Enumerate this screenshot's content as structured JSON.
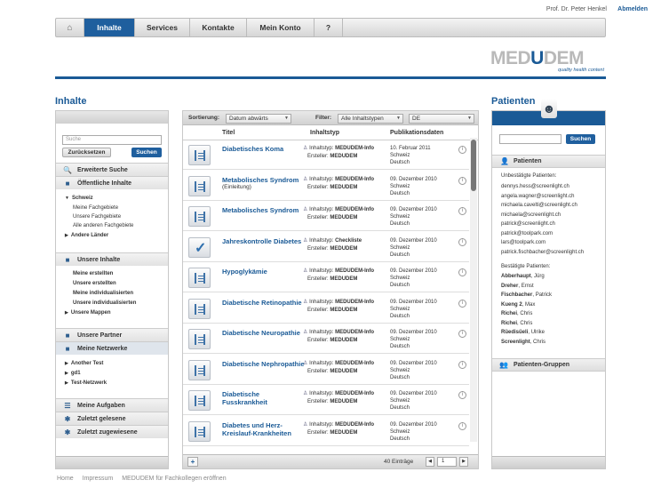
{
  "header": {
    "user": "Prof. Dr. Peter Henkel",
    "logout": "Abmelden"
  },
  "nav": {
    "home_icon": "home-icon",
    "items": [
      "Inhalte",
      "Services",
      "Kontakte",
      "Mein Konto",
      "?"
    ],
    "active": "Inhalte"
  },
  "logo": {
    "text_a": "MED",
    "text_b": "U",
    "text_c": "DEM",
    "tagline": "quality health content"
  },
  "sections": {
    "left_title": "Inhalte",
    "right_title": "Patienten"
  },
  "left": {
    "search_placeholder": "Suche",
    "reset": "Zurücksetzen",
    "search": "Suchen",
    "adv": "Erweiterte Suche",
    "public": "Öffentliche Inhalte",
    "schweiz": "Schweiz",
    "fach1": "Meine Fachgebiete",
    "fach2": "Unsere Fachgebiete",
    "fach3": "Alle anderen Fachgebiete",
    "andere": "Andere Länder",
    "unsere": "Unsere Inhalte",
    "u1": "Meine erstellten",
    "u2": "Unsere erstellten",
    "u3": "Meine individualisierten",
    "u4": "Unsere individualisierten",
    "u5": "Unsere Mappen",
    "partner": "Unsere Partner",
    "netz": "Meine Netzwerke",
    "n1": "Another Test",
    "n2": "gd1",
    "n3": "Test-Netzwerk",
    "aufg": "Meine Aufgaben",
    "gel": "Zuletzt gelesene",
    "zug": "Zuletzt zugewiesene"
  },
  "content": {
    "sort_label": "Sortierung:",
    "sort_value": "Datum abwärts",
    "filter_label": "Filter:",
    "filter_value": "Alle Inhaltstypen",
    "lang_value": "DE",
    "col_title": "Titel",
    "col_type": "Inhaltstyp",
    "col_date": "Publikationsdaten",
    "rows": [
      {
        "title": "Diabetisches Koma",
        "sub": "",
        "type": "MEDUDEM-Info",
        "creator": "MEDUDEM",
        "date": "10. Februar 2011",
        "country": "Schweiz",
        "lang": "Deutsch",
        "icon": "doc"
      },
      {
        "title": "Metabolisches Syndrom",
        "sub": "(Einleitung)",
        "type": "MEDUDEM-Info",
        "creator": "MEDUDEM",
        "date": "09. Dezember 2010",
        "country": "Schweiz",
        "lang": "Deutsch",
        "icon": "doc"
      },
      {
        "title": "Metabolisches Syndrom",
        "sub": "",
        "type": "MEDUDEM-Info",
        "creator": "MEDUDEM",
        "date": "09. Dezember 2010",
        "country": "Schweiz",
        "lang": "Deutsch",
        "icon": "doc"
      },
      {
        "title": "Jahreskontrolle Diabetes",
        "sub": "",
        "type": "Checkliste",
        "creator": "MEDUDEM",
        "date": "09. Dezember 2010",
        "country": "Schweiz",
        "lang": "Deutsch",
        "icon": "check"
      },
      {
        "title": "Hypoglykämie",
        "sub": "",
        "type": "MEDUDEM-Info",
        "creator": "MEDUDEM",
        "date": "09. Dezember 2010",
        "country": "Schweiz",
        "lang": "Deutsch",
        "icon": "doc"
      },
      {
        "title": "Diabetische Retinopathie",
        "sub": "",
        "type": "MEDUDEM-Info",
        "creator": "MEDUDEM",
        "date": "09. Dezember 2010",
        "country": "Schweiz",
        "lang": "Deutsch",
        "icon": "doc"
      },
      {
        "title": "Diabetische Neuropathie",
        "sub": "",
        "type": "MEDUDEM-Info",
        "creator": "MEDUDEM",
        "date": "09. Dezember 2010",
        "country": "Schweiz",
        "lang": "Deutsch",
        "icon": "doc"
      },
      {
        "title": "Diabetische Nephropathie",
        "sub": "",
        "type": "MEDUDEM-Info",
        "creator": "MEDUDEM",
        "date": "09. Dezember 2010",
        "country": "Schweiz",
        "lang": "Deutsch",
        "icon": "doc"
      },
      {
        "title": "Diabetische Fusskrankheit",
        "sub": "",
        "type": "MEDUDEM-Info",
        "creator": "MEDUDEM",
        "date": "09. Dezember 2010",
        "country": "Schweiz",
        "lang": "Deutsch",
        "icon": "doc"
      },
      {
        "title": "Diabetes und Herz-Kreislauf-Krankheiten",
        "sub": "",
        "type": "MEDUDEM-Info",
        "creator": "MEDUDEM",
        "date": "09. Dezember 2010",
        "country": "Schweiz",
        "lang": "Deutsch",
        "icon": "doc"
      }
    ],
    "type_label": "Inhaltstyp:",
    "creator_label": "Ersteller:",
    "add": "+",
    "count": "40 Einträge",
    "page": "1",
    "page_of": "1"
  },
  "right": {
    "search": "Suchen",
    "patients": "Patienten",
    "unconfirmed_label": "Unbestätigte Patienten:",
    "unconfirmed": [
      "dennys.hess@screenlight.ch",
      "angela.wagner@screenlight.ch",
      "michaela.cavelti@screenlight.ch",
      "michaela@screenlight.ch",
      "patrick@screenlight.ch",
      "patrick@toolpark.com",
      "lars@toolpark.com",
      "patrick.fischbacher@screenlight.ch"
    ],
    "confirmed_label": "Bestätigte Patienten:",
    "confirmed": [
      [
        "Abberhaupt",
        "Jürg"
      ],
      [
        "Dreher",
        "Ernst"
      ],
      [
        "Fischbacher",
        "Patrick"
      ],
      [
        "Kueng 2",
        "Max"
      ],
      [
        "Richei",
        "Chris"
      ],
      [
        "Richei",
        "Chris"
      ],
      [
        "Rüedisüeli",
        "Ulrike"
      ],
      [
        "Screenlight",
        "Chris"
      ]
    ],
    "groups": "Patienten-Gruppen"
  },
  "footer_links": [
    "Home",
    "Impressum",
    "MEDUDEM für Fachkollegen eröffnen"
  ]
}
